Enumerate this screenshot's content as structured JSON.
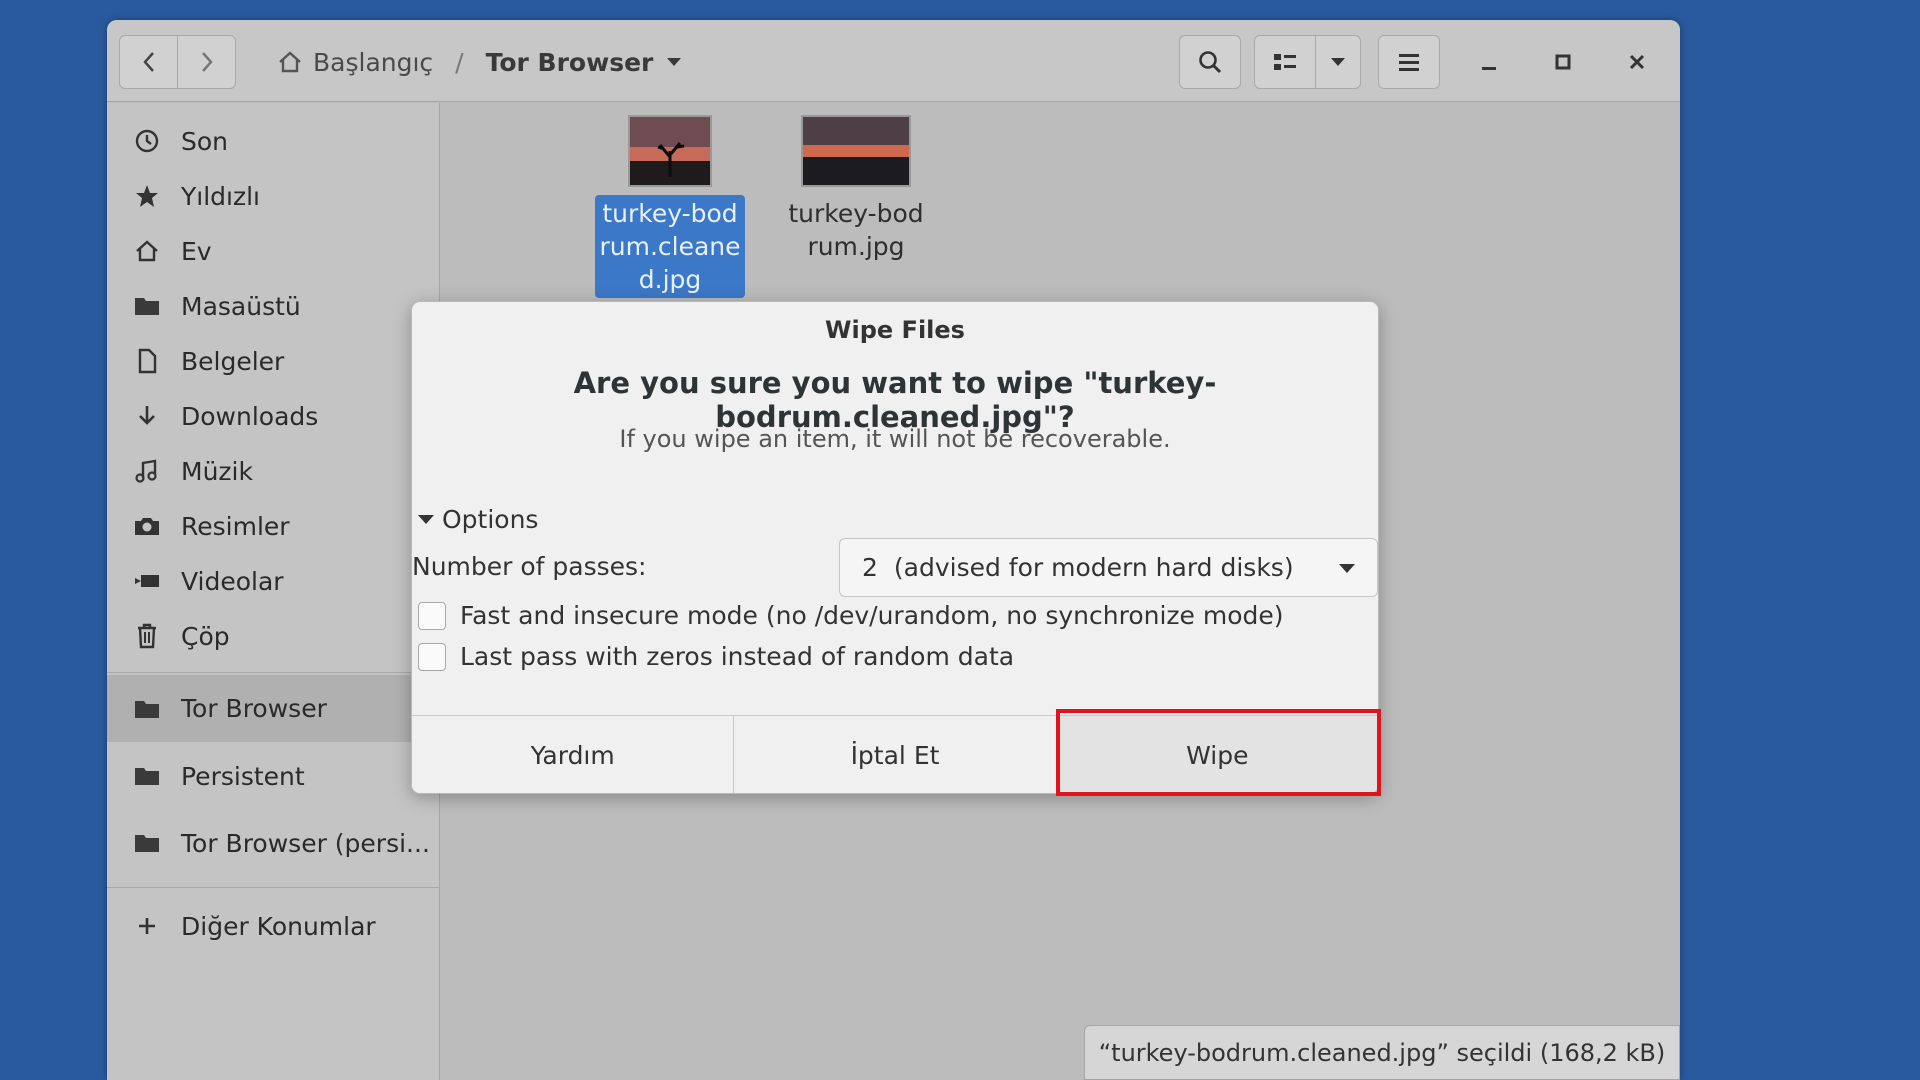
{
  "header": {
    "back_icon": "chevron-left-icon",
    "forward_icon": "chevron-right-icon",
    "path_home": "Başlangıç",
    "path_separator": "/",
    "path_current": "Tor Browser",
    "search_icon": "search-icon",
    "view_icon": "list-view-icon",
    "menu_icon": "hamburger-menu-icon"
  },
  "sidebar": {
    "items": [
      {
        "label": "Son",
        "icon": "clock-icon"
      },
      {
        "label": "Yıldızlı",
        "icon": "star-icon"
      },
      {
        "label": "Ev",
        "icon": "home-icon"
      },
      {
        "label": "Masaüstü",
        "icon": "folder-icon"
      },
      {
        "label": "Belgeler",
        "icon": "document-icon"
      },
      {
        "label": "Downloads",
        "icon": "download-icon"
      },
      {
        "label": "Müzik",
        "icon": "music-icon"
      },
      {
        "label": "Resimler",
        "icon": "camera-icon"
      },
      {
        "label": "Videolar",
        "icon": "video-icon"
      },
      {
        "label": "Çöp",
        "icon": "trash-icon"
      }
    ],
    "bookmarks": [
      {
        "label": "Tor Browser",
        "icon": "folder-icon",
        "active": true
      },
      {
        "label": "Persistent",
        "icon": "folder-icon"
      },
      {
        "label": "Tor Browser (persi...",
        "icon": "folder-icon"
      }
    ],
    "other": {
      "label": "Diğer Konumlar",
      "icon": "plus-icon"
    }
  },
  "files": [
    {
      "name": "turkey-bodrum.cleaned.jpg",
      "selected": true
    },
    {
      "name": "turkey-bodrum.jpg",
      "selected": false
    }
  ],
  "status": "“turkey-bodrum.cleaned.jpg” seçildi  (168,2 kB)",
  "dialog": {
    "title": "Wipe Files",
    "question": "Are you sure you want to wipe \"turkey-bodrum.cleaned.jpg\"?",
    "subtitle": "If you wipe an item, it will not be recoverable.",
    "options_label": "Options",
    "passes_label": "Number of passes:",
    "passes_value": "2",
    "passes_desc": "(advised for modern hard disks)",
    "check_fast": "Fast and insecure mode (no /dev/urandom, no synchronize mode)",
    "check_zeros": "Last pass with zeros instead of random data",
    "buttons": {
      "help": "Yardım",
      "cancel": "İptal Et",
      "wipe": "Wipe"
    }
  },
  "colors": {
    "desktop": "#2a5a9e",
    "selection": "#3c78c8",
    "highlight": "#e0141e"
  }
}
